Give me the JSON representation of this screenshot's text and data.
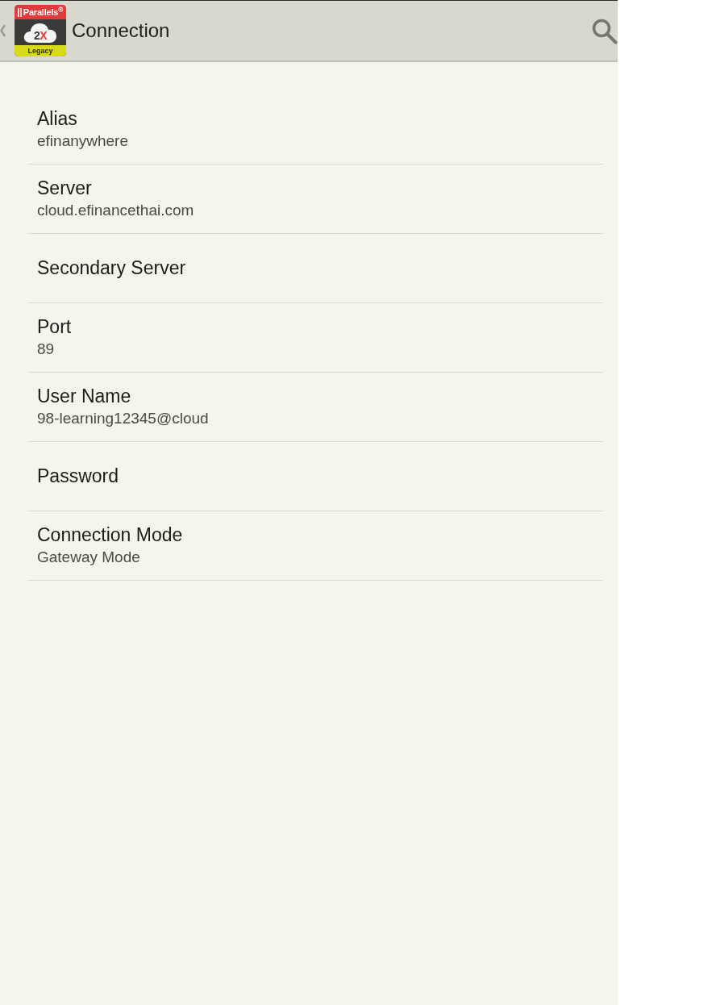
{
  "app_bar": {
    "logo": {
      "brand": "Parallels$^{®}$",
      "mark_digit": "2",
      "mark_letter": "X",
      "edition": "Legacy"
    },
    "title": "Connection"
  },
  "preferences": [
    {
      "title": "Alias",
      "summary": "efinanywhere"
    },
    {
      "title": "Server",
      "summary": "cloud.efinancethai.com"
    },
    {
      "title": "Secondary Server"
    },
    {
      "title": "Port",
      "summary": "89"
    },
    {
      "title": "User Name",
      "summary": "98-learning12345@cloud"
    },
    {
      "title": "Password"
    },
    {
      "title": "Connection Mode",
      "summary": "Gateway Mode"
    }
  ]
}
